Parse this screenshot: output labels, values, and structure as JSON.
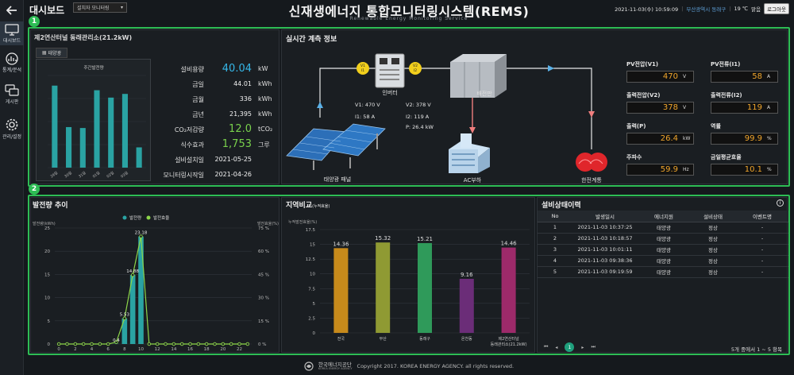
{
  "header": {
    "dashboard_label": "대시보드",
    "monitor_select": "설치자 모니터링",
    "title": "신재생에너지 통합모니터링시스템(REMS)",
    "subtitle": "Renewable Energy Monitoring Service",
    "datetime": "2021-11-03(수) 10:59:09",
    "location": "부산광역시 동래구",
    "temperature": "19 ℃",
    "weather": "맑음",
    "logout": "로그아웃"
  },
  "sidebar": {
    "items": [
      {
        "label": "대시보드",
        "icon": "monitor-icon"
      },
      {
        "label": "통계/분석",
        "icon": "chart-icon"
      },
      {
        "label": "게시판",
        "icon": "chat-icon"
      },
      {
        "label": "관리/설정",
        "icon": "gear-icon"
      }
    ]
  },
  "badges": {
    "one": "1",
    "two": "2"
  },
  "facility": {
    "title": "제2연산터널 동래관리소(21.2kW)",
    "tab": "태양광",
    "mini_chart_title": "주간발전량",
    "mini_days": [
      "29일",
      "30일",
      "31일",
      "01일",
      "02일",
      "03일"
    ],
    "mini_values": [
      178,
      88,
      86,
      168,
      152,
      160,
      44
    ],
    "metrics": [
      {
        "key": "설비용량",
        "value": "40.04",
        "unit": "kW",
        "style": "blue"
      },
      {
        "key": "금일",
        "value": "44.01",
        "unit": "kWh",
        "style": ""
      },
      {
        "key": "금월",
        "value": "336",
        "unit": "kWh",
        "style": ""
      },
      {
        "key": "금년",
        "value": "21,395",
        "unit": "kWh",
        "style": ""
      },
      {
        "key": "CO₂저감량",
        "value": "12.0",
        "unit": "tCO₂",
        "style": "green"
      },
      {
        "key": "식수효과",
        "value": "1,753",
        "unit": "그루",
        "style": "green"
      },
      {
        "key": "설비설치일",
        "value": "2021-05-25",
        "unit": "",
        "style": ""
      },
      {
        "key": "모니터링시작일",
        "value": "2021-04-26",
        "unit": "",
        "style": ""
      }
    ]
  },
  "realtime": {
    "title": "실시간 계측 정보",
    "v1_badge": "V1\nI1",
    "v2_badge": "V2\nI2",
    "inverter_label": "인버터",
    "panel_label": "배전판",
    "v1": "V1: 470 V",
    "i1": "I1: 58 A",
    "v2": "V2: 378 V",
    "i2": "I2: 119 A",
    "p": "P: 26.4 kW",
    "solar_label": "태양광 패널",
    "load_label": "AC부하",
    "grid_label": "한전계통",
    "readouts": [
      {
        "key": "PV전압(V1)",
        "value": "470",
        "unit": "V"
      },
      {
        "key": "PV전류(I1)",
        "value": "58",
        "unit": "A"
      },
      {
        "key": "출력전압(V2)",
        "value": "378",
        "unit": "V"
      },
      {
        "key": "출력전류(I2)",
        "value": "119",
        "unit": "A"
      },
      {
        "key": "출력(P)",
        "value": "26.4",
        "unit": "kW"
      },
      {
        "key": "역률",
        "value": "99.9",
        "unit": "%"
      },
      {
        "key": "주파수",
        "value": "59.9",
        "unit": "Hz"
      },
      {
        "key": "금일평균효율",
        "value": "10.1",
        "unit": "%"
      }
    ]
  },
  "generation": {
    "title": "발전량 추이",
    "legend_gen": "발전량",
    "legend_eff": "발전효율",
    "ylabel_left": "발전량(kWh)",
    "ylabel_right": "발전효율(%)"
  },
  "region": {
    "title": "지역비교",
    "title_sub": "(누적효율)",
    "ylabel": "누적발전효율(%)"
  },
  "history": {
    "title": "설비상태이력",
    "columns": [
      "No",
      "발생일시",
      "에너지원",
      "설비상태",
      "이벤트명"
    ],
    "rows": [
      [
        "1",
        "2021-11-03 10:37:25",
        "태양광",
        "정상",
        "-"
      ],
      [
        "2",
        "2021-11-03 10:18:57",
        "태양광",
        "정상",
        "-"
      ],
      [
        "3",
        "2021-11-03 10:01:11",
        "태양광",
        "정상",
        "-"
      ],
      [
        "4",
        "2021-11-03 09:38:36",
        "태양광",
        "정상",
        "-"
      ],
      [
        "5",
        "2021-11-03 09:19:59",
        "태양광",
        "정상",
        "-"
      ]
    ],
    "page": "1",
    "summary": "5개 중에서 1 ~ 5 항목"
  },
  "footer": {
    "org_ko": "한국에너지공단",
    "org_en": "KOREA ENERGY AGENCY",
    "copyright": "Copyright 2017. KOREA ENERGY AGENCY. all rights reserved."
  },
  "chart_data": [
    {
      "type": "bar",
      "title": "발전량 추이",
      "x": [
        0,
        1,
        2,
        3,
        4,
        5,
        6,
        7,
        8,
        9,
        10,
        11,
        12,
        13,
        14,
        15,
        16,
        17,
        18,
        19,
        20,
        21,
        22,
        23
      ],
      "series": [
        {
          "name": "발전량",
          "values": [
            0,
            0,
            0,
            0,
            0,
            0,
            0,
            0.04,
            5.53,
            14.88,
            23.18,
            0,
            0,
            0,
            0,
            0,
            0,
            0,
            0,
            0,
            0,
            0,
            0,
            0
          ]
        },
        {
          "name": "발전효율",
          "values": [
            0,
            0,
            0,
            0,
            0,
            0,
            0,
            0.4,
            5.53,
            14.88,
            23.18,
            0,
            0,
            0,
            0,
            0,
            0,
            0,
            0,
            0,
            0,
            0,
            0,
            0
          ]
        }
      ],
      "ylim": [
        0,
        25
      ],
      "ylim_right": [
        0,
        75
      ],
      "yticks": [
        0,
        5,
        10,
        15,
        20,
        25
      ],
      "yticks_right": [
        "0 %",
        "15 %",
        "30 %",
        "45 %",
        "60 %",
        "75 %"
      ],
      "xticks": [
        0,
        2,
        4,
        6,
        8,
        10,
        12,
        14,
        16,
        18,
        20,
        22
      ],
      "data_labels": [
        {
          "x": 7,
          "text": "0.4"
        },
        {
          "x": 8,
          "text": "5.53"
        },
        {
          "x": 9,
          "text": "14.88"
        },
        {
          "x": 10,
          "text": "23.18"
        }
      ],
      "colors": {
        "bar": "#2aa3a3",
        "line": "#8dd64a"
      }
    },
    {
      "type": "bar",
      "title": "지역비교",
      "ylabel": "누적발전효율(%)",
      "categories": [
        "전국",
        "부산",
        "동래구",
        "온천동",
        "제2연산터널 동래관리소(21.2kW)"
      ],
      "category_lines": [
        [
          "전국"
        ],
        [
          "부산"
        ],
        [
          "동래구"
        ],
        [
          "온천동"
        ],
        [
          "제2연산터널",
          "동래관리소(21.2kW)"
        ]
      ],
      "values": [
        14.36,
        15.32,
        15.21,
        9.16,
        14.46
      ],
      "colors": [
        "#c78a1b",
        "#8f9a33",
        "#2f9a5a",
        "#6b2d78",
        "#9d2a6a"
      ],
      "ylim": [
        0,
        17.5
      ],
      "yticks": [
        0,
        2.5,
        5,
        7.5,
        10,
        12.5,
        15,
        17.5
      ]
    }
  ]
}
